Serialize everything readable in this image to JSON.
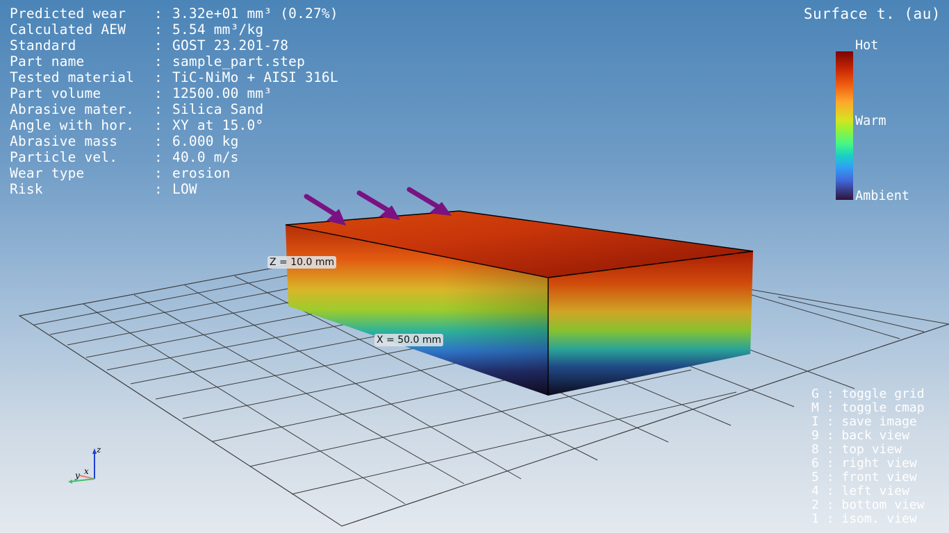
{
  "info": [
    {
      "label": "Predicted wear",
      "sep": ":",
      "value": "3.32e+01 mm³ (0.27%)"
    },
    {
      "label": "Calculated AEW",
      "sep": ":",
      "value": "5.54 mm³/kg"
    },
    {
      "label": "Standard",
      "sep": ":",
      "value": "GOST 23.201-78"
    },
    {
      "label": "Part name",
      "sep": ":",
      "value": "sample_part.step"
    },
    {
      "label": "Tested material",
      "sep": ":",
      "value": "TiC-NiMo + AISI 316L"
    },
    {
      "label": "Part volume",
      "sep": ":",
      "value": "12500.00 mm³"
    },
    {
      "label": "Abrasive mater.",
      "sep": ":",
      "value": "Silica Sand"
    },
    {
      "label": "Angle with hor.",
      "sep": ":",
      "value": "XY at 15.0°"
    },
    {
      "label": "Abrasive mass",
      "sep": ":",
      "value": "6.000 kg"
    },
    {
      "label": "Particle vel.",
      "sep": ":",
      "value": "40.0 m/s"
    },
    {
      "label": "Wear type",
      "sep": ":",
      "value": "erosion"
    },
    {
      "label": "Risk",
      "sep": ":",
      "value": "LOW"
    }
  ],
  "scalar_title": "Surface t. (au)",
  "colorbar": {
    "hot": "Hot",
    "warm": "Warm",
    "ambient": "Ambient"
  },
  "dimensions": {
    "z": "Z = 10.0 mm",
    "x": "X = 50.0 mm"
  },
  "axes": {
    "z": "z",
    "x": "x",
    "y": "y"
  },
  "keys": [
    {
      "key": "G",
      "sep": ":",
      "action": "toggle grid"
    },
    {
      "key": "M",
      "sep": ":",
      "action": "toggle cmap"
    },
    {
      "key": "I",
      "sep": ":",
      "action": "save image"
    },
    {
      "key": "9",
      "sep": ":",
      "action": "back view"
    },
    {
      "key": "8",
      "sep": ":",
      "action": "top view"
    },
    {
      "key": "6",
      "sep": ":",
      "action": "right view"
    },
    {
      "key": "5",
      "sep": ":",
      "action": "front view"
    },
    {
      "key": "4",
      "sep": ":",
      "action": "left view"
    },
    {
      "key": "2",
      "sep": ":",
      "action": "bottom view"
    },
    {
      "key": "1",
      "sep": ":",
      "action": "isom. view"
    }
  ],
  "colors": {
    "arrow": "#7a1282",
    "axis_z": "#1f3fd6",
    "axis_x": "#e8806a",
    "axis_y": "#3fbf6a",
    "grid_line": "#3a3a3a"
  }
}
